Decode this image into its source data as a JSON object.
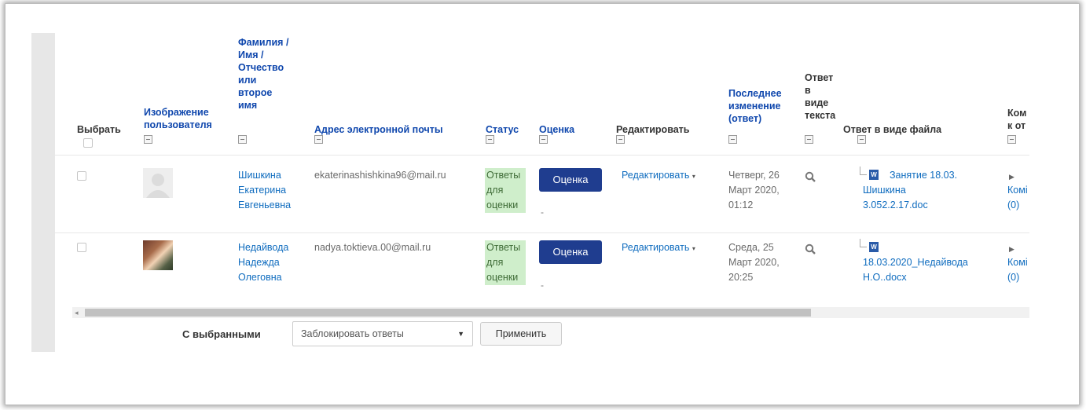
{
  "columns": {
    "select": "Выбрать",
    "image": [
      "Изображение",
      "пользователя"
    ],
    "name": [
      "Фамилия /",
      "Имя /",
      "Отчество",
      "или",
      "второе",
      "имя"
    ],
    "email": "Адрес электронной почты",
    "status": "Статус",
    "grade": "Оценка",
    "edit": "Редактировать",
    "modified": [
      "Последнее",
      "изменение",
      "(ответ)"
    ],
    "text_answer": [
      "Ответ",
      "в",
      "виде",
      "текста"
    ],
    "file_answer": "Ответ в виде файла",
    "comments": [
      "Ком",
      "к от"
    ]
  },
  "rows": [
    {
      "name": [
        "Шишкина",
        "Екатерина",
        "Евгеньевна"
      ],
      "email": "ekaterinashishkina96@mail.ru",
      "status": [
        "Ответы",
        "для",
        "оценки"
      ],
      "grade_button": "Оценка",
      "grade_dash": "-",
      "edit": "Редактировать",
      "modified": [
        "Четверг, 26",
        "Март 2020,",
        "01:12"
      ],
      "file": [
        "Занятие 18.03.",
        "Шишкина",
        "3.052.2.17.doc"
      ],
      "comments": [
        "Комі",
        "(0)"
      ],
      "avatar": "default-avatar"
    },
    {
      "name": [
        "Недайвода",
        "Надежда",
        "Олеговна"
      ],
      "email": "nadya.toktieva.00@mail.ru",
      "status": [
        "Ответы",
        "для",
        "оценки"
      ],
      "grade_button": "Оценка",
      "grade_dash": "-",
      "edit": "Редактировать",
      "modified": [
        "Среда, 25",
        "Март 2020,",
        "20:25"
      ],
      "file": [
        "18.03.2020_Недайвода",
        "Н.О..docx"
      ],
      "comments": [
        "Комі",
        "(0)"
      ],
      "avatar": "photo-avatar"
    }
  ],
  "bulk": {
    "label": "С выбранными",
    "select_value": "Заблокировать ответы",
    "apply": "Применить"
  },
  "colors": {
    "link": "#0f6cbf",
    "header_link": "#0f47ad",
    "grade_button": "#1f3d8f",
    "status_bg": "#cfeecb"
  }
}
